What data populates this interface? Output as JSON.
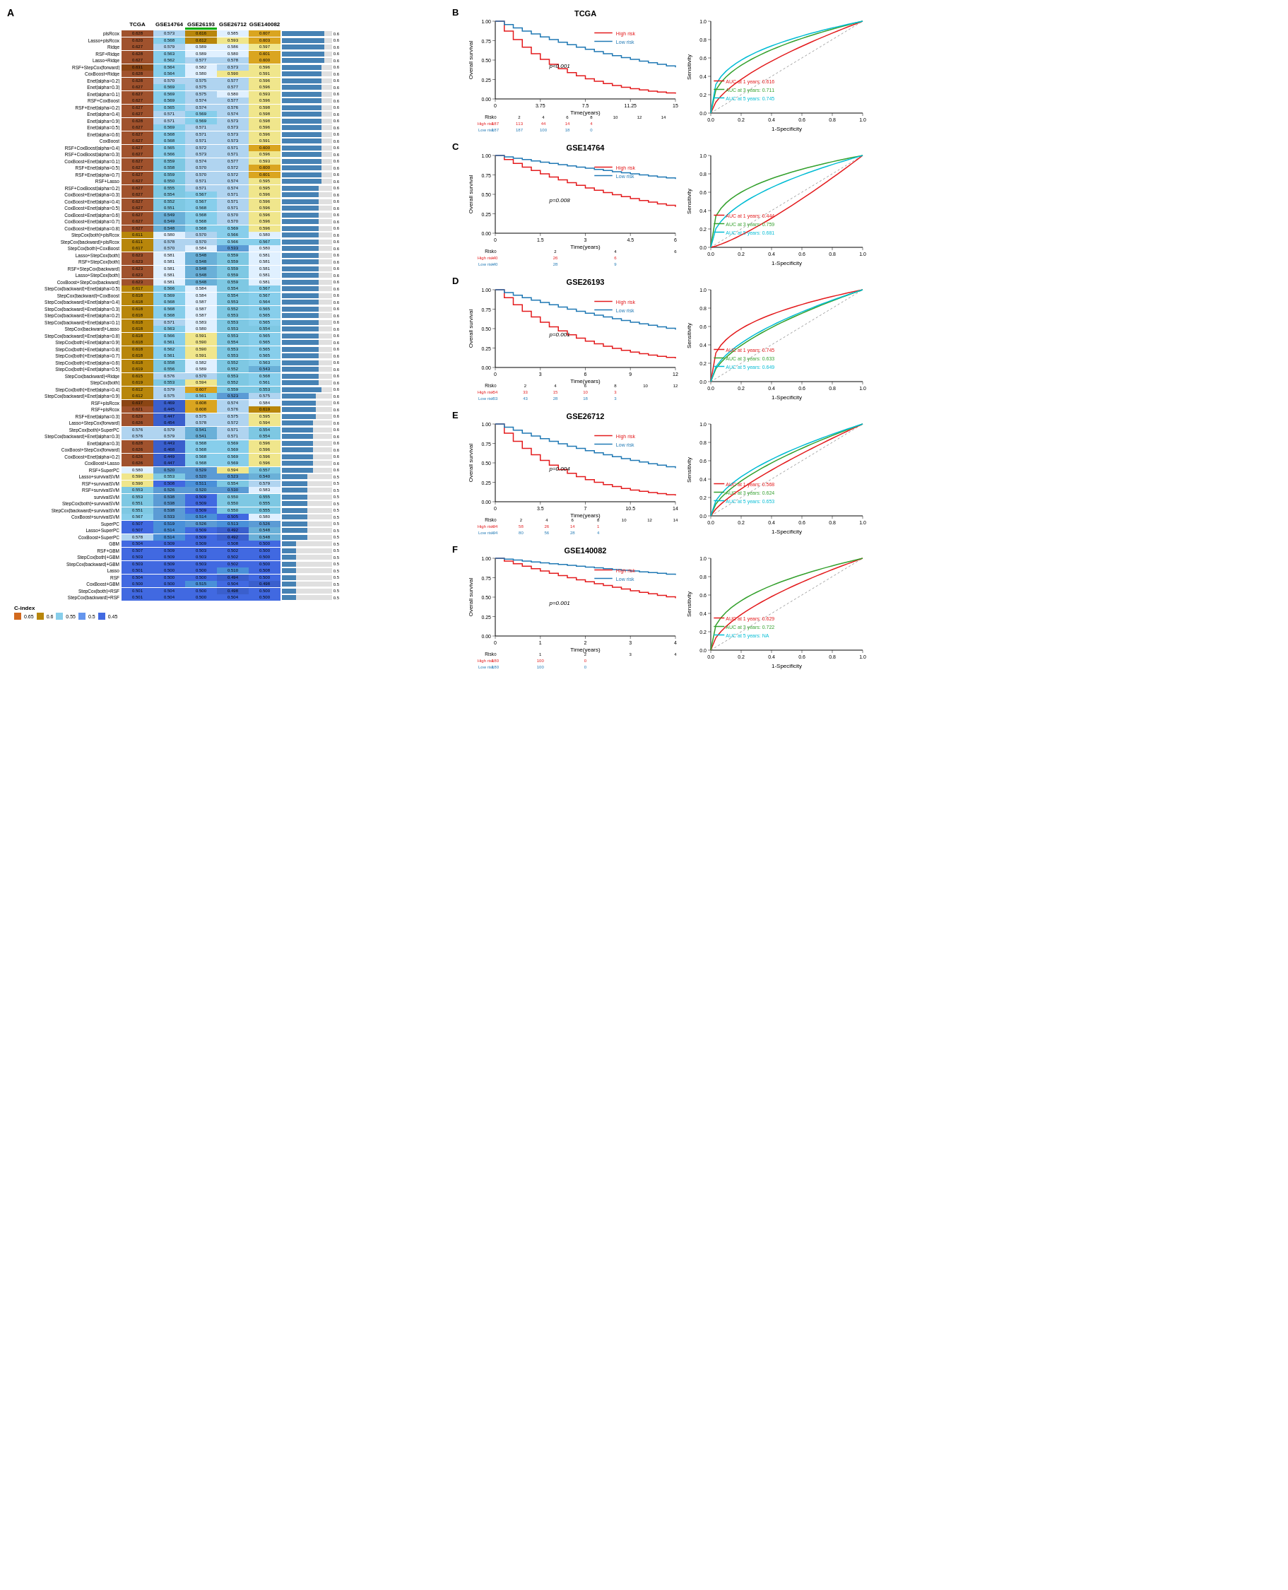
{
  "panel_a_label": "A",
  "panel_labels": [
    "B",
    "C",
    "D",
    "E",
    "F"
  ],
  "dataset_labels": [
    "TCGA",
    "GSE14764",
    "GSE26193",
    "GSE26712",
    "GSE140082"
  ],
  "legend": {
    "title": "C-index",
    "values": [
      "0.65",
      "0.6",
      "0.55",
      "0.5",
      "0.45"
    ]
  },
  "rows": [
    {
      "label": "plsRcox",
      "tcga": 0.628,
      "gse14764": 0.573,
      "gse26193": 0.616,
      "gse26712": 0.585,
      "gse140082": 0.607,
      "bar": 0.6
    },
    {
      "label": "Lasso+plsRcox",
      "tcga": 0.62,
      "gse14764": 0.568,
      "gse26193": 0.612,
      "gse26712": 0.593,
      "gse140082": 0.603,
      "bar": 0.6
    },
    {
      "label": "Ridge",
      "tcga": 0.627,
      "gse14764": 0.579,
      "gse26193": 0.589,
      "gse26712": 0.586,
      "gse140082": 0.597,
      "bar": 0.6
    },
    {
      "label": "RSF+Ridge",
      "tcga": 0.628,
      "gse14764": 0.563,
      "gse26193": 0.589,
      "gse26712": 0.58,
      "gse140082": 0.601,
      "bar": 0.6
    },
    {
      "label": "Lasso+Ridge",
      "tcga": 0.627,
      "gse14764": 0.562,
      "gse26193": 0.577,
      "gse26712": 0.578,
      "gse140082": 0.6,
      "bar": 0.6
    },
    {
      "label": "RSF+StepCox[forward]",
      "tcga": 0.631,
      "gse14764": 0.564,
      "gse26193": 0.582,
      "gse26712": 0.573,
      "gse140082": 0.596,
      "bar": 0.59
    },
    {
      "label": "CoxBoost+Ridge",
      "tcga": 0.628,
      "gse14764": 0.564,
      "gse26193": 0.58,
      "gse26712": 0.59,
      "gse140082": 0.591,
      "bar": 0.59
    },
    {
      "label": "Enet[alpha=0.2]",
      "tcga": 0.628,
      "gse14764": 0.57,
      "gse26193": 0.575,
      "gse26712": 0.577,
      "gse140082": 0.596,
      "bar": 0.59
    },
    {
      "label": "Enet[alpha=0.3]",
      "tcga": 0.627,
      "gse14764": 0.569,
      "gse26193": 0.575,
      "gse26712": 0.577,
      "gse140082": 0.596,
      "bar": 0.59
    },
    {
      "label": "Enet[alpha=0.1]",
      "tcga": 0.627,
      "gse14764": 0.569,
      "gse26193": 0.575,
      "gse26712": 0.58,
      "gse140082": 0.593,
      "bar": 0.59
    },
    {
      "label": "RSF+CoxBoost",
      "tcga": 0.627,
      "gse14764": 0.569,
      "gse26193": 0.574,
      "gse26712": 0.577,
      "gse140082": 0.596,
      "bar": 0.59
    },
    {
      "label": "RSF+Enet[alpha=0.2]",
      "tcga": 0.627,
      "gse14764": 0.565,
      "gse26193": 0.574,
      "gse26712": 0.576,
      "gse140082": 0.598,
      "bar": 0.59
    },
    {
      "label": "Enet[alpha=0.4]",
      "tcga": 0.627,
      "gse14764": 0.571,
      "gse26193": 0.569,
      "gse26712": 0.574,
      "gse140082": 0.598,
      "bar": 0.59
    },
    {
      "label": "Enet[alpha=0.9]",
      "tcga": 0.628,
      "gse14764": 0.571,
      "gse26193": 0.569,
      "gse26712": 0.573,
      "gse140082": 0.598,
      "bar": 0.59
    },
    {
      "label": "Enet[alpha=0.5]",
      "tcga": 0.627,
      "gse14764": 0.569,
      "gse26193": 0.571,
      "gse26712": 0.573,
      "gse140082": 0.596,
      "bar": 0.59
    },
    {
      "label": "Enet[alpha=0.6]",
      "tcga": 0.627,
      "gse14764": 0.568,
      "gse26193": 0.571,
      "gse26712": 0.573,
      "gse140082": 0.596,
      "bar": 0.59
    },
    {
      "label": "CoxBoost",
      "tcga": 0.627,
      "gse14764": 0.568,
      "gse26193": 0.571,
      "gse26712": 0.573,
      "gse140082": 0.591,
      "bar": 0.59
    },
    {
      "label": "RSF+CoxBoost[alpha=0.4]",
      "tcga": 0.627,
      "gse14764": 0.565,
      "gse26193": 0.572,
      "gse26712": 0.571,
      "gse140082": 0.6,
      "bar": 0.59
    },
    {
      "label": "RSF+CoxBoost[alpha=0.3]",
      "tcga": 0.627,
      "gse14764": 0.566,
      "gse26193": 0.573,
      "gse26712": 0.571,
      "gse140082": 0.596,
      "bar": 0.59
    },
    {
      "label": "CoxBoost+Enet[alpha=0.1]",
      "tcga": 0.627,
      "gse14764": 0.559,
      "gse26193": 0.574,
      "gse26712": 0.577,
      "gse140082": 0.593,
      "bar": 0.59
    },
    {
      "label": "RSF+Enet[alpha=0.5]",
      "tcga": 0.627,
      "gse14764": 0.558,
      "gse26193": 0.57,
      "gse26712": 0.572,
      "gse140082": 0.6,
      "bar": 0.59
    },
    {
      "label": "RSF+Enet[alpha=0.7]",
      "tcga": 0.627,
      "gse14764": 0.559,
      "gse26193": 0.57,
      "gse26712": 0.572,
      "gse140082": 0.601,
      "bar": 0.59
    },
    {
      "label": "RSF+Lasso",
      "tcga": 0.627,
      "gse14764": 0.55,
      "gse26193": 0.571,
      "gse26712": 0.574,
      "gse140082": 0.595,
      "bar": 0.59
    },
    {
      "label": "RSF+CoxBoost[alpha=0.2]",
      "tcga": 0.627,
      "gse14764": 0.555,
      "gse26193": 0.571,
      "gse26712": 0.574,
      "gse140082": 0.595,
      "bar": 0.58
    },
    {
      "label": "CoxBoost+Enet[alpha=0.3]",
      "tcga": 0.627,
      "gse14764": 0.554,
      "gse26193": 0.567,
      "gse26712": 0.571,
      "gse140082": 0.596,
      "bar": 0.58
    },
    {
      "label": "CoxBoost+Enet[alpha=0.4]",
      "tcga": 0.627,
      "gse14764": 0.552,
      "gse26193": 0.567,
      "gse26712": 0.571,
      "gse140082": 0.596,
      "bar": 0.58
    },
    {
      "label": "CoxBoost+Enet[alpha=0.5]",
      "tcga": 0.627,
      "gse14764": 0.551,
      "gse26193": 0.568,
      "gse26712": 0.571,
      "gse140082": 0.596,
      "bar": 0.58
    },
    {
      "label": "CoxBoost+Enet[alpha=0.6]",
      "tcga": 0.627,
      "gse14764": 0.549,
      "gse26193": 0.568,
      "gse26712": 0.57,
      "gse140082": 0.596,
      "bar": 0.58
    },
    {
      "label": "CoxBoost+Enet[alpha=0.7]",
      "tcga": 0.627,
      "gse14764": 0.549,
      "gse26193": 0.568,
      "gse26712": 0.57,
      "gse140082": 0.596,
      "bar": 0.58
    },
    {
      "label": "CoxBoost+Enet[alpha=0.8]",
      "tcga": 0.627,
      "gse14764": 0.548,
      "gse26193": 0.568,
      "gse26712": 0.569,
      "gse140082": 0.596,
      "bar": 0.58
    },
    {
      "label": "StepCox[both]+plsRcox",
      "tcga": 0.611,
      "gse14764": 0.58,
      "gse26193": 0.57,
      "gse26712": 0.566,
      "gse140082": 0.58,
      "bar": 0.58
    },
    {
      "label": "StepCox[backward]+plsRcox",
      "tcga": 0.611,
      "gse14764": 0.578,
      "gse26193": 0.57,
      "gse26712": 0.566,
      "gse140082": 0.567,
      "bar": 0.58
    },
    {
      "label": "StepCox[both]+CoxBoost",
      "tcga": 0.617,
      "gse14764": 0.57,
      "gse26193": 0.584,
      "gse26712": 0.533,
      "gse140082": 0.58,
      "bar": 0.58
    },
    {
      "label": "Lasso+StepCox[both]",
      "tcga": 0.623,
      "gse14764": 0.581,
      "gse26193": 0.548,
      "gse26712": 0.559,
      "gse140082": 0.581,
      "bar": 0.58
    },
    {
      "label": "RSF+StepCox[both]",
      "tcga": 0.623,
      "gse14764": 0.581,
      "gse26193": 0.548,
      "gse26712": 0.559,
      "gse140082": 0.581,
      "bar": 0.58
    },
    {
      "label": "RSF+StepCox[backward]",
      "tcga": 0.623,
      "gse14764": 0.581,
      "gse26193": 0.548,
      "gse26712": 0.559,
      "gse140082": 0.581,
      "bar": 0.58
    },
    {
      "label": "Lasso+StepCox[both]",
      "tcga": 0.623,
      "gse14764": 0.581,
      "gse26193": 0.548,
      "gse26712": 0.559,
      "gse140082": 0.581,
      "bar": 0.58
    },
    {
      "label": "CoxBoost+StepCox[backward]",
      "tcga": 0.623,
      "gse14764": 0.581,
      "gse26193": 0.548,
      "gse26712": 0.559,
      "gse140082": 0.581,
      "bar": 0.58
    },
    {
      "label": "StepCox[backward]+Enet[alpha=0.5]",
      "tcga": 0.617,
      "gse14764": 0.566,
      "gse26193": 0.584,
      "gse26712": 0.554,
      "gse140082": 0.567,
      "bar": 0.58
    },
    {
      "label": "StepCox[backward]+CoxBoost",
      "tcga": 0.618,
      "gse14764": 0.569,
      "gse26193": 0.584,
      "gse26712": 0.554,
      "gse140082": 0.567,
      "bar": 0.58
    },
    {
      "label": "StepCox[backward]+Enet[alpha=0.4]",
      "tcga": 0.618,
      "gse14764": 0.568,
      "gse26193": 0.587,
      "gse26712": 0.553,
      "gse140082": 0.564,
      "bar": 0.58
    },
    {
      "label": "StepCox[backward]+Enet[alpha=0.3]",
      "tcga": 0.618,
      "gse14764": 0.568,
      "gse26193": 0.587,
      "gse26712": 0.552,
      "gse140082": 0.565,
      "bar": 0.58
    },
    {
      "label": "StepCox[backward]+Enet[alpha=0.2]",
      "tcga": 0.618,
      "gse14764": 0.568,
      "gse26193": 0.587,
      "gse26712": 0.553,
      "gse140082": 0.565,
      "bar": 0.58
    },
    {
      "label": "StepCox[backward]+Enet[alpha=0.1]",
      "tcga": 0.618,
      "gse14764": 0.571,
      "gse26193": 0.583,
      "gse26712": 0.553,
      "gse140082": 0.565,
      "bar": 0.58
    },
    {
      "label": "StepCox[backward]+Lasso",
      "tcga": 0.618,
      "gse14764": 0.563,
      "gse26193": 0.58,
      "gse26712": 0.553,
      "gse140082": 0.554,
      "bar": 0.58
    },
    {
      "label": "StepCox[backward]+Enet[alpha=0.8]",
      "tcga": 0.618,
      "gse14764": 0.566,
      "gse26193": 0.591,
      "gse26712": 0.553,
      "gse140082": 0.565,
      "bar": 0.58
    },
    {
      "label": "StepCox[both]+Enet[alpha=0.9]",
      "tcga": 0.618,
      "gse14764": 0.561,
      "gse26193": 0.59,
      "gse26712": 0.554,
      "gse140082": 0.565,
      "bar": 0.58
    },
    {
      "label": "StepCox[both]+Enet[alpha=0.8]",
      "tcga": 0.618,
      "gse14764": 0.562,
      "gse26193": 0.59,
      "gse26712": 0.553,
      "gse140082": 0.565,
      "bar": 0.58
    },
    {
      "label": "StepCox[both]+Enet[alpha=0.7]",
      "tcga": 0.618,
      "gse14764": 0.561,
      "gse26193": 0.591,
      "gse26712": 0.553,
      "gse140082": 0.565,
      "bar": 0.58
    },
    {
      "label": "StepCox[both]+Enet[alpha=0.6]",
      "tcga": 0.618,
      "gse14764": 0.558,
      "gse26193": 0.582,
      "gse26712": 0.552,
      "gse140082": 0.563,
      "bar": 0.58
    },
    {
      "label": "StepCox[both]+Enet[alpha=0.5]",
      "tcga": 0.619,
      "gse14764": 0.556,
      "gse26193": 0.589,
      "gse26712": 0.552,
      "gse140082": 0.543,
      "bar": 0.58
    },
    {
      "label": "StepCox[backward]+Ridge",
      "tcga": 0.615,
      "gse14764": 0.576,
      "gse26193": 0.57,
      "gse26712": 0.553,
      "gse140082": 0.568,
      "bar": 0.58
    },
    {
      "label": "StepCox[both]",
      "tcga": 0.619,
      "gse14764": 0.553,
      "gse26193": 0.594,
      "gse26712": 0.552,
      "gse140082": 0.561,
      "bar": 0.58
    },
    {
      "label": "StepCox[both]+Enet[alpha=0.4]",
      "tcga": 0.612,
      "gse14764": 0.579,
      "gse26193": 0.607,
      "gse26712": 0.559,
      "gse140082": 0.553,
      "bar": 0.59
    },
    {
      "label": "StepCox[backward]+Enet[alpha=0.9]",
      "tcga": 0.612,
      "gse14764": 0.575,
      "gse26193": 0.561,
      "gse26712": 0.523,
      "gse140082": 0.575,
      "bar": 0.57
    },
    {
      "label": "RSF+plsRcox",
      "tcga": 0.637,
      "gse14764": 0.469,
      "gse26193": 0.608,
      "gse26712": 0.574,
      "gse140082": 0.584,
      "bar": 0.57
    },
    {
      "label": "RSF+plsRcox",
      "tcga": 0.621,
      "gse14764": 0.445,
      "gse26193": 0.608,
      "gse26712": 0.576,
      "gse140082": 0.619,
      "bar": 0.57
    },
    {
      "label": "RSF+Enet[alpha=0.3]",
      "tcga": 0.629,
      "gse14764": 0.447,
      "gse26193": 0.575,
      "gse26712": 0.575,
      "gse140082": 0.595,
      "bar": 0.57
    },
    {
      "label": "Lasso+StepCox[forward]",
      "tcga": 0.626,
      "gse14764": 0.454,
      "gse26193": 0.578,
      "gse26712": 0.572,
      "gse140082": 0.594,
      "bar": 0.56
    },
    {
      "label": "StepCox[both]+SuperPC",
      "tcga": 0.576,
      "gse14764": 0.579,
      "gse26193": 0.541,
      "gse26712": 0.571,
      "gse140082": 0.554,
      "bar": 0.56
    },
    {
      "label": "StepCox[backward]+Enet[alpha=0.3]",
      "tcga": 0.576,
      "gse14764": 0.579,
      "gse26193": 0.541,
      "gse26712": 0.571,
      "gse140082": 0.554,
      "bar": 0.56
    },
    {
      "label": "Enet[alpha=0.3]",
      "tcga": 0.628,
      "gse14764": 0.443,
      "gse26193": 0.568,
      "gse26712": 0.569,
      "gse140082": 0.596,
      "bar": 0.56
    },
    {
      "label": "CoxBoost+StepCox[forward]",
      "tcga": 0.626,
      "gse14764": 0.468,
      "gse26193": 0.568,
      "gse26712": 0.569,
      "gse140082": 0.596,
      "bar": 0.56
    },
    {
      "label": "CoxBoost+Enet[alpha=0.2]",
      "tcga": 0.626,
      "gse14764": 0.449,
      "gse26193": 0.568,
      "gse26712": 0.569,
      "gse140082": 0.596,
      "bar": 0.56
    },
    {
      "label": "CoxBoost+Lasso",
      "tcga": 0.626,
      "gse14764": 0.447,
      "gse26193": 0.568,
      "gse26712": 0.569,
      "gse140082": 0.596,
      "bar": 0.56
    },
    {
      "label": "RSF+SuperPC",
      "tcga": 0.58,
      "gse14764": 0.52,
      "gse26193": 0.529,
      "gse26712": 0.594,
      "gse140082": 0.557,
      "bar": 0.56
    },
    {
      "label": "Lasso+survivalSVM",
      "tcga": 0.59,
      "gse14764": 0.553,
      "gse26193": 0.52,
      "gse26712": 0.523,
      "gse140082": 0.54,
      "bar": 0.54
    },
    {
      "label": "RSF+survivalSVM",
      "tcga": 0.59,
      "gse14764": 0.508,
      "gse26193": 0.511,
      "gse26712": 0.554,
      "gse140082": 0.579,
      "bar": 0.54
    },
    {
      "label": "RSF+survivalSVM",
      "tcga": 0.553,
      "gse14764": 0.526,
      "gse26193": 0.52,
      "gse26712": 0.53,
      "gse140082": 0.583,
      "bar": 0.54
    },
    {
      "label": "survivalSVM",
      "tcga": 0.553,
      "gse14764": 0.538,
      "gse26193": 0.509,
      "gse26712": 0.55,
      "gse140082": 0.555,
      "bar": 0.54
    },
    {
      "label": "StepCox[both]+survivalSVM",
      "tcga": 0.551,
      "gse14764": 0.538,
      "gse26193": 0.509,
      "gse26712": 0.55,
      "gse140082": 0.555,
      "bar": 0.54
    },
    {
      "label": "StepCox[backward]+survivalSVM",
      "tcga": 0.551,
      "gse14764": 0.538,
      "gse26193": 0.509,
      "gse26712": 0.55,
      "gse140082": 0.555,
      "bar": 0.54
    },
    {
      "label": "CoxBoost+survivalSVM",
      "tcga": 0.567,
      "gse14764": 0.533,
      "gse26193": 0.514,
      "gse26712": 0.505,
      "gse140082": 0.58,
      "bar": 0.54
    },
    {
      "label": "SuperPC",
      "tcga": 0.507,
      "gse14764": 0.519,
      "gse26193": 0.526,
      "gse26712": 0.513,
      "gse140082": 0.526,
      "bar": 0.54
    },
    {
      "label": "Lasso+SuperPC",
      "tcga": 0.507,
      "gse14764": 0.514,
      "gse26193": 0.509,
      "gse26712": 0.492,
      "gse140082": 0.548,
      "bar": 0.54
    },
    {
      "label": "CoxBoost+SuperPC",
      "tcga": 0.578,
      "gse14764": 0.514,
      "gse26193": 0.509,
      "gse26712": 0.492,
      "gse140082": 0.548,
      "bar": 0.54
    },
    {
      "label": "GBM",
      "tcga": 0.504,
      "gse14764": 0.509,
      "gse26193": 0.509,
      "gse26712": 0.508,
      "gse140082": 0.5,
      "bar": 0.5
    },
    {
      "label": "RSF+GBM",
      "tcga": 0.507,
      "gse14764": 0.509,
      "gse26193": 0.503,
      "gse26712": 0.502,
      "gse140082": 0.5,
      "bar": 0.5
    },
    {
      "label": "StepCox[both]+GBM",
      "tcga": 0.503,
      "gse14764": 0.509,
      "gse26193": 0.503,
      "gse26712": 0.502,
      "gse140082": 0.5,
      "bar": 0.5
    },
    {
      "label": "StepCox[backward]+GBM",
      "tcga": 0.503,
      "gse14764": 0.509,
      "gse26193": 0.503,
      "gse26712": 0.502,
      "gse140082": 0.5,
      "bar": 0.5
    },
    {
      "label": "Lasso",
      "tcga": 0.501,
      "gse14764": 0.5,
      "gse26193": 0.5,
      "gse26712": 0.51,
      "gse140082": 0.508,
      "bar": 0.5
    },
    {
      "label": "RSF",
      "tcga": 0.504,
      "gse14764": 0.5,
      "gse26193": 0.5,
      "gse26712": 0.494,
      "gse140082": 0.5,
      "bar": 0.5
    },
    {
      "label": "CoxBoost+GBM",
      "tcga": 0.5,
      "gse14764": 0.5,
      "gse26193": 0.515,
      "gse26712": 0.504,
      "gse140082": 0.498,
      "bar": 0.5
    },
    {
      "label": "StepCox[both]+RSF",
      "tcga": 0.501,
      "gse14764": 0.504,
      "gse26193": 0.5,
      "gse26712": 0.498,
      "gse140082": 0.5,
      "bar": 0.5
    },
    {
      "label": "StepCox[backward]+RSF",
      "tcga": 0.501,
      "gse14764": 0.504,
      "gse26193": 0.5,
      "gse26712": 0.504,
      "gse140082": 0.5,
      "bar": 0.5
    }
  ],
  "survival_panels": [
    {
      "id": "B",
      "title": "TCGA",
      "pval": "p<0.001",
      "xmax": 15,
      "xlabel": "Time(years)",
      "ytitle": "Overall survival",
      "risk_high": [
        187,
        113,
        44,
        14,
        4
      ],
      "risk_low": [
        187,
        187,
        100,
        18,
        0
      ],
      "risk_times": [
        0,
        2,
        4,
        6,
        8,
        10,
        12,
        14
      ],
      "auc1": "0.616",
      "auc3": "0.711",
      "auc5": "0.745"
    },
    {
      "id": "C",
      "title": "GSE14764",
      "pval": "p=0.008",
      "xmax": 6,
      "xlabel": "Time(years)",
      "ytitle": "Overall survival",
      "risk_high": [
        40,
        26,
        6
      ],
      "risk_low": [
        40,
        28,
        9
      ],
      "risk_times": [
        0,
        2,
        4,
        6
      ],
      "auc1": "0.444",
      "auc3": "0.759",
      "auc5": "0.681"
    },
    {
      "id": "D",
      "title": "GSE26193",
      "pval": "p=0.001",
      "xmax": 12,
      "xlabel": "Time(years)",
      "ytitle": "Overall survival",
      "risk_high": [
        54,
        33,
        15,
        10,
        3
      ],
      "risk_low": [
        53,
        43,
        28,
        18,
        3
      ],
      "risk_times": [
        0,
        2,
        4,
        6,
        8,
        10,
        12
      ],
      "auc1": "0.745",
      "auc3": "0.633",
      "auc5": "0.649"
    },
    {
      "id": "E",
      "title": "GSE26712",
      "pval": "p=0.004",
      "xmax": 14,
      "xlabel": "Time(years)",
      "ytitle": "Overall survival",
      "risk_high": [
        94,
        58,
        26,
        14,
        1
      ],
      "risk_low": [
        94,
        80,
        56,
        28,
        4
      ],
      "risk_times": [
        0,
        2,
        4,
        6,
        8,
        10,
        12,
        14
      ],
      "auc1": "0.568",
      "auc3": "0.624",
      "auc5": "0.653"
    },
    {
      "id": "F",
      "title": "GSE140082",
      "pval": "p=0.001",
      "xmax": 4,
      "xlabel": "Time(years)",
      "ytitle": "Overall survival",
      "risk_high": [
        180,
        100,
        0
      ],
      "risk_low": [
        180,
        100,
        0
      ],
      "risk_times": [
        0,
        1,
        2,
        3,
        4
      ],
      "auc1": "0.629",
      "auc3": "0.722",
      "auc5": "NA"
    }
  ],
  "colors": {
    "high_risk": "#E31A1C",
    "low_risk": "#1F78B4",
    "roc_1yr": "#E31A1C",
    "roc_3yr": "#33A02C",
    "roc_5yr": "#00BCD4",
    "bar_color": "#4682B4"
  }
}
